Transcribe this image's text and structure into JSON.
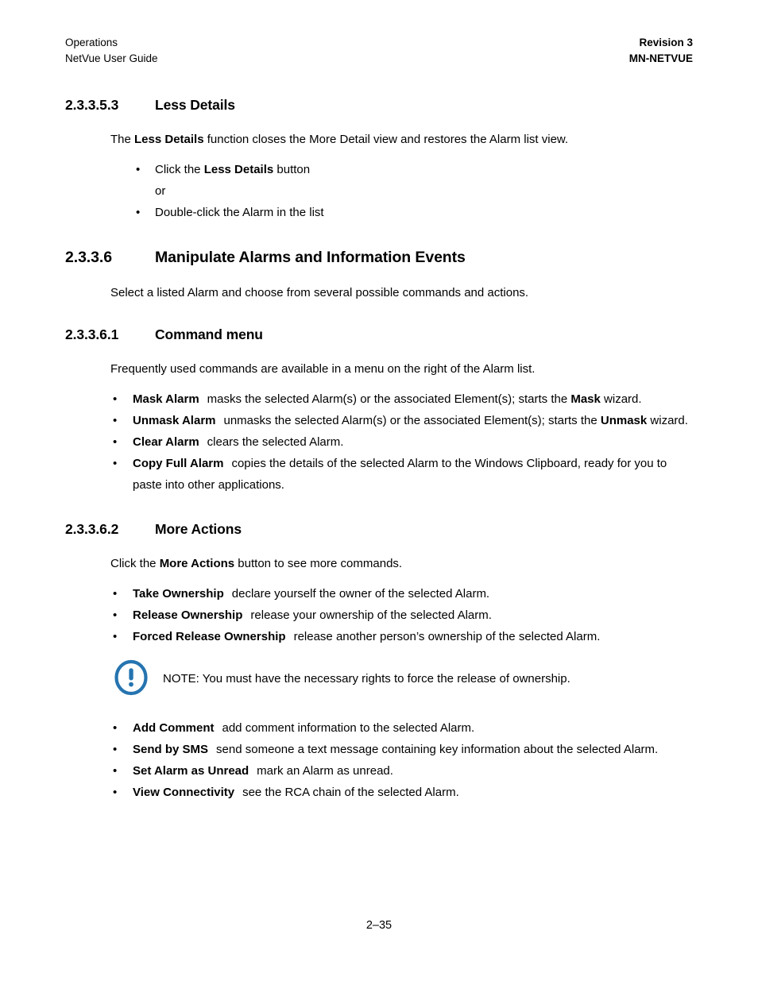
{
  "header": {
    "left_line1": "Operations",
    "left_line2": "NetVue User Guide",
    "right_line1": "Revision 3",
    "right_line2": "MN-NETVUE"
  },
  "footer": {
    "page_number": "2–35"
  },
  "colors": {
    "note_icon_blue": "#2574b0",
    "text": "#000000",
    "page_background": "#ffffff"
  },
  "sections": {
    "less_details": {
      "number": "2.3.3.5.3",
      "title": "Less Details",
      "intro_pre": "The ",
      "intro_bold": "Less Details",
      "intro_post": " function closes the More Detail view and restores the Alarm list view.",
      "bullet1_pre": "Click the ",
      "bullet1_bold": "Less Details",
      "bullet1_post": " button",
      "or_text": "or",
      "bullet2": "Double-click the Alarm in the list"
    },
    "manipulate": {
      "number": "2.3.3.6",
      "title": "Manipulate Alarms and Information Events",
      "intro": "Select a listed Alarm and choose from several possible commands and actions."
    },
    "command_menu": {
      "number": "2.3.3.6.1",
      "title": "Command menu",
      "intro": "Frequently used commands are available in a menu on the right of the Alarm list.",
      "items": [
        {
          "lead": "Mask Alarm",
          "text_pre": "masks the selected Alarm(s) or the associated Element(s); starts the ",
          "text_bold": "Mask",
          "text_post": " wizard."
        },
        {
          "lead": "Unmask Alarm",
          "text_pre": "unmasks the selected Alarm(s) or the associated Element(s); starts the ",
          "text_bold": "Unmask",
          "text_post": " wizard."
        },
        {
          "lead": "Clear Alarm",
          "text_pre": "clears the selected Alarm.",
          "text_bold": "",
          "text_post": ""
        },
        {
          "lead": "Copy Full Alarm",
          "text_pre": "copies the details of the selected Alarm to the Windows Clipboard, ready for you to paste into other applications.",
          "text_bold": "",
          "text_post": ""
        }
      ]
    },
    "more_actions": {
      "number": "2.3.3.6.2",
      "title": "More Actions",
      "intro_pre": "Click the ",
      "intro_bold": "More Actions",
      "intro_post": " button to see more commands.",
      "items_before_note": [
        {
          "lead": "Take Ownership",
          "text": "declare yourself the owner of the selected Alarm."
        },
        {
          "lead": "Release Ownership",
          "text": "release your ownership of the selected Alarm."
        },
        {
          "lead": "Forced Release Ownership",
          "text": "release another person’s ownership of the selected Alarm."
        }
      ],
      "note": {
        "icon": "exclamation-circle-icon",
        "text": "NOTE:  You must have the necessary rights to force the release of ownership."
      },
      "items_after_note": [
        {
          "lead": "Add Comment",
          "text": "add comment information to the selected Alarm."
        },
        {
          "lead": "Send by SMS",
          "text": "send someone a text message containing key information about the selected Alarm."
        },
        {
          "lead": "Set Alarm as Unread",
          "text": "mark an Alarm as unread."
        },
        {
          "lead": "View Connectivity",
          "text": "see the RCA chain of the selected Alarm."
        }
      ]
    }
  }
}
